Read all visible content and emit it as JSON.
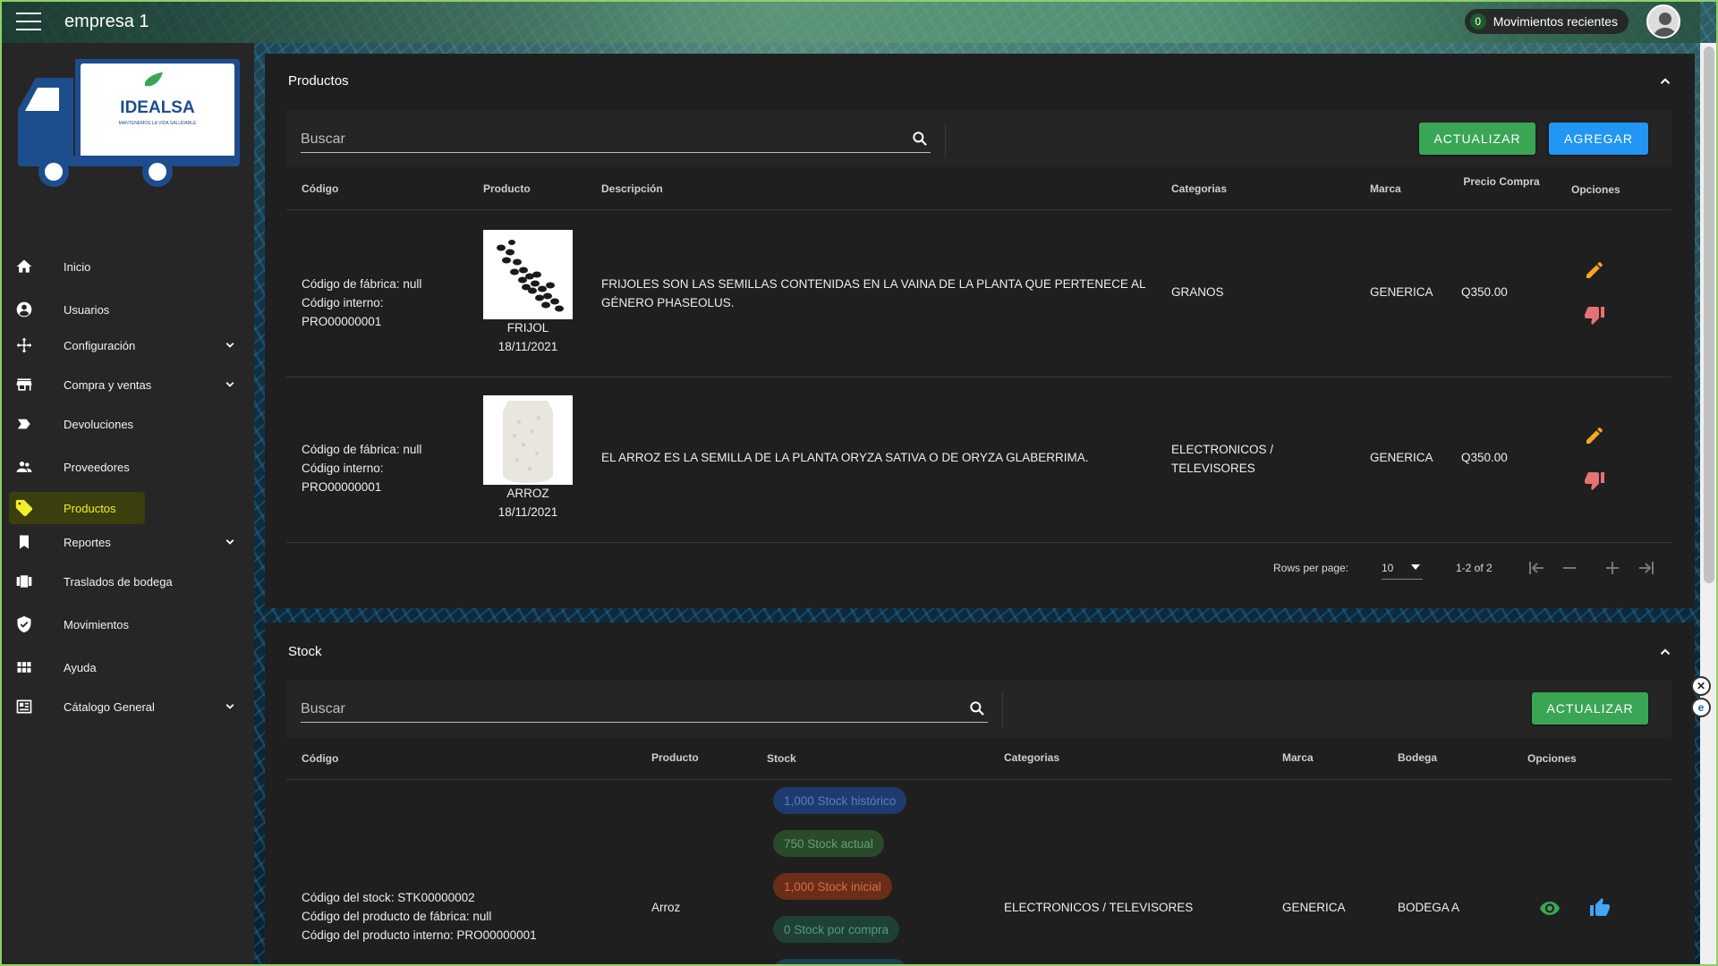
{
  "topbar": {
    "title": "empresa 1",
    "recent_count": "0",
    "recent_label": "Movimientos recientes"
  },
  "logo": {
    "brand": "IDEALSA",
    "tagline": "MANTENEMOS LA VIDA SALUDABLE"
  },
  "sidebar": {
    "items": [
      {
        "label": "Inicio",
        "icon": "home-icon"
      },
      {
        "label": "Usuarios",
        "icon": "account-circle-icon"
      },
      {
        "label": "Configuración",
        "icon": "move-arrows-icon",
        "expandable": true
      },
      {
        "label": "Compra y ventas",
        "icon": "store-icon",
        "expandable": true
      },
      {
        "label": "Devoluciones",
        "icon": "label-arrow-icon"
      },
      {
        "label": "Proveedores",
        "icon": "people-icon"
      },
      {
        "label": "Productos",
        "icon": "tag-icon",
        "active": true
      },
      {
        "label": "Reportes",
        "icon": "bookmark-icon",
        "expandable": true
      },
      {
        "label": "Traslados de bodega",
        "icon": "view-carousel-icon"
      },
      {
        "label": "Movimientos",
        "icon": "shield-check-icon"
      },
      {
        "label": "Ayuda",
        "icon": "grid-icon"
      },
      {
        "label": "Cátalogo General",
        "icon": "newspaper-icon",
        "expandable": true
      }
    ]
  },
  "productos": {
    "title": "Productos",
    "search_placeholder": "Buscar",
    "btn_update": "ACTUALIZAR",
    "btn_add": "AGREGAR",
    "headers": {
      "codigo": "Código",
      "producto": "Producto",
      "descripcion": "Descripción",
      "categorias": "Categorias",
      "marca": "Marca",
      "precio": "Precio Compra",
      "opciones": "Opciones"
    },
    "rows": [
      {
        "codigo_fabrica": "Código de fábrica: null",
        "codigo_interno_label": "Código interno:",
        "codigo_interno": "PRO00000001",
        "nombre": "FRIJOL",
        "fecha": "18/11/2021",
        "descripcion": "FRIJOLES SON LAS SEMILLAS CONTENIDAS EN LA VAINA DE LA PLANTA QUE PERTENECE AL GÉNERO PHASEOLUS.",
        "categoria": "GRANOS",
        "marca": "GENERICA",
        "precio": "Q350.00"
      },
      {
        "codigo_fabrica": "Código de fábrica: null",
        "codigo_interno_label": "Código interno:",
        "codigo_interno": "PRO00000001",
        "nombre": "ARROZ",
        "fecha": "18/11/2021",
        "descripcion": "EL ARROZ ES LA SEMILLA DE LA PLANTA ORYZA SATIVA O DE ORYZA GLABERRIMA.",
        "categoria": "ELECTRONICOS / TELEVISORES",
        "marca": "GENERICA",
        "precio": "Q350.00"
      }
    ],
    "pagination": {
      "rows_per_page_label": "Rows per page:",
      "rows_per_page": "10",
      "range": "1-2 of 2"
    }
  },
  "stock": {
    "title": "Stock",
    "search_placeholder": "Buscar",
    "btn_update": "ACTUALIZAR",
    "headers": {
      "codigo": "Código",
      "producto": "Producto",
      "stock": "Stock",
      "categorias": "Categorias",
      "marca": "Marca",
      "bodega": "Bodega",
      "opciones": "Opciones"
    },
    "rows": [
      {
        "codigo_stock": "Código del stock: STK00000002",
        "codigo_fabrica": "Código del producto de fábrica: null",
        "codigo_interno": "Código del producto interno: PRO00000001",
        "producto": "Arroz",
        "chips": [
          {
            "text": "1,000 Stock histórico",
            "color": "#1f3a6e",
            "text_color": "#4f74b8"
          },
          {
            "text": "750 Stock actual",
            "color": "#2a4a2c",
            "text_color": "#5c9b63"
          },
          {
            "text": "1,000 Stock inicial",
            "color": "#6a2d17",
            "text_color": "#c7683f"
          },
          {
            "text": "0 Stock por compra",
            "color": "#1f4034",
            "text_color": "#4e8f75"
          }
        ],
        "categoria": "ELECTRONICOS / TELEVISORES",
        "marca": "GENERICA",
        "bodega": "BODEGA A"
      }
    ]
  },
  "colors": {
    "accent_green": "#3aa655",
    "accent_blue": "#2196f3",
    "active_nav": "#f1ee2a",
    "edit": "#f5a623",
    "dislike": "#e57373"
  }
}
